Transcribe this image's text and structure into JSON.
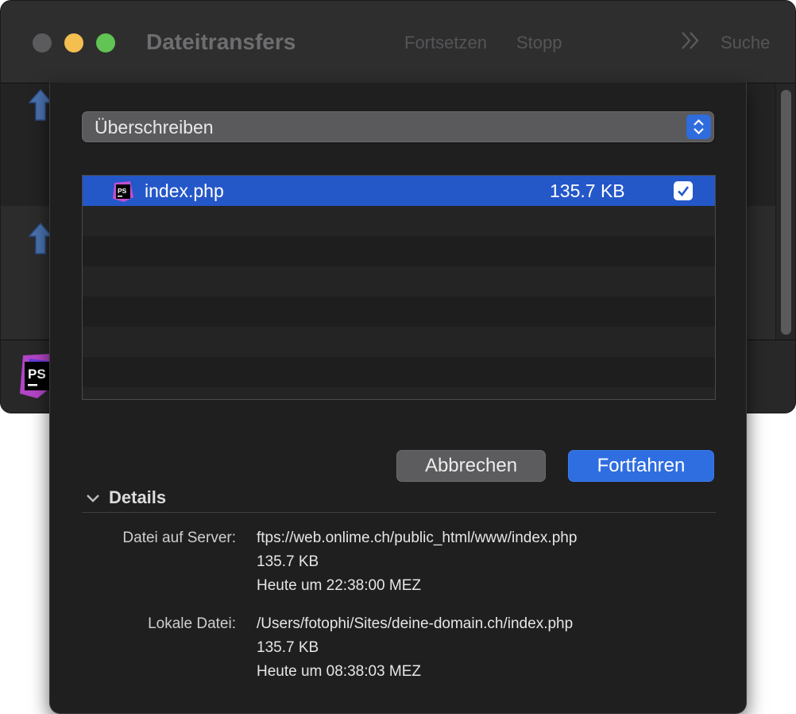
{
  "window": {
    "title": "Dateitransfers",
    "toolbar": {
      "resume_label": "Fortsetzen",
      "stop_label": "Stopp",
      "more_icon": "chevrons-right-icon",
      "search_label": "Suche"
    }
  },
  "sheet": {
    "action_popup": {
      "selected": "Überschreiben"
    },
    "file_list": {
      "rows": [
        {
          "name": "index.php",
          "size": "135.7 KB",
          "checked": true,
          "icon": "phpstorm-icon"
        }
      ]
    },
    "buttons": {
      "cancel": "Abbrechen",
      "continue": "Fortfahren"
    },
    "details": {
      "heading": "Details",
      "server": {
        "label": "Datei auf Server:",
        "path": "ftps://web.onlime.ch/public_html/www/index.php",
        "size": "135.7 KB",
        "modified": "Heute um 22:38:00 MEZ"
      },
      "local": {
        "label": "Lokale Datei:",
        "path": "/Users/fotophi/Sites/deine-domain.ch/index.php",
        "size": "135.7 KB",
        "modified": "Heute um 08:38:03 MEZ"
      }
    }
  },
  "colors": {
    "accent": "#2f6ee0",
    "selection": "#2457c8",
    "close_light": "#5b5b5d",
    "minimize_light": "#f4bf4f",
    "zoom_light": "#61c454"
  }
}
